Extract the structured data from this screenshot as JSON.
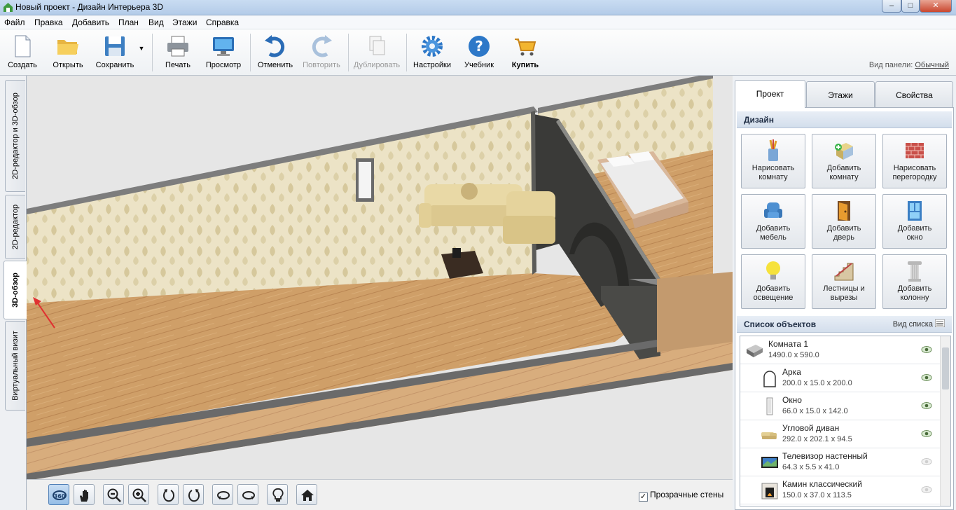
{
  "window": {
    "title": "Новый проект - Дизайн Интерьера 3D",
    "minimize": "–",
    "maximize": "□",
    "close": "✕"
  },
  "menu": [
    "Файл",
    "Правка",
    "Добавить",
    "План",
    "Вид",
    "Этажи",
    "Справка"
  ],
  "toolbar": {
    "create": "Создать",
    "open": "Открыть",
    "save": "Сохранить",
    "print": "Печать",
    "preview": "Просмотр",
    "undo": "Отменить",
    "redo": "Повторить",
    "duplicate": "Дублировать",
    "settings": "Настройки",
    "tutorial": "Учебник",
    "buy": "Купить"
  },
  "panel_view": {
    "label": "Вид панели:",
    "value": "Обычный"
  },
  "left_tabs": [
    "2D-редактор и 3D-обзор",
    "2D-редактор",
    "3D-обзор",
    "Виртуальный визит"
  ],
  "left_tab_active": "3D-обзор",
  "right_tabs": [
    "Проект",
    "Этажи",
    "Свойства"
  ],
  "right_tab_active": "Проект",
  "design": {
    "header": "Дизайн",
    "buttons": [
      {
        "label1": "Нарисовать",
        "label2": "комнату",
        "icon": "brush-pencil-icon"
      },
      {
        "label1": "Добавить",
        "label2": "комнату",
        "icon": "add-room-icon"
      },
      {
        "label1": "Нарисовать",
        "label2": "перегородку",
        "icon": "brick-wall-icon"
      },
      {
        "label1": "Добавить",
        "label2": "мебель",
        "icon": "armchair-icon"
      },
      {
        "label1": "Добавить",
        "label2": "дверь",
        "icon": "door-icon"
      },
      {
        "label1": "Добавить",
        "label2": "окно",
        "icon": "window-icon"
      },
      {
        "label1": "Добавить",
        "label2": "освещение",
        "icon": "lightbulb-icon"
      },
      {
        "label1": "Лестницы и",
        "label2": "вырезы",
        "icon": "stairs-icon"
      },
      {
        "label1": "Добавить",
        "label2": "колонну",
        "icon": "column-icon"
      }
    ]
  },
  "objects": {
    "header": "Список объектов",
    "view_list": "Вид списка",
    "items": [
      {
        "name": "Комната 1",
        "size": "1490.0 x 590.0",
        "icon": "room-icon",
        "visible": true
      },
      {
        "name": "Арка",
        "size": "200.0 x 15.0 x 200.0",
        "icon": "arch-icon",
        "visible": true
      },
      {
        "name": "Окно",
        "size": "66.0 x 15.0 x 142.0",
        "icon": "window-icon",
        "visible": true
      },
      {
        "name": "Угловой диван",
        "size": "292.0 x 202.1 x 94.5",
        "icon": "sofa-icon",
        "visible": true
      },
      {
        "name": "Телевизор настенный",
        "size": "64.3 x 5.5 x 41.0",
        "icon": "tv-icon",
        "visible": false
      },
      {
        "name": "Камин классический",
        "size": "150.0 x 37.0 x 113.5",
        "icon": "fireplace-icon",
        "visible": false
      }
    ]
  },
  "bottom": {
    "transparent_walls": "Прозрачные стены",
    "transparent_checked": true
  },
  "colors": {
    "accent": "#4f7fb6",
    "floor": "#c99a63",
    "wallpaper": "#e9dfc0",
    "dark_wall": "#3a3a38"
  }
}
